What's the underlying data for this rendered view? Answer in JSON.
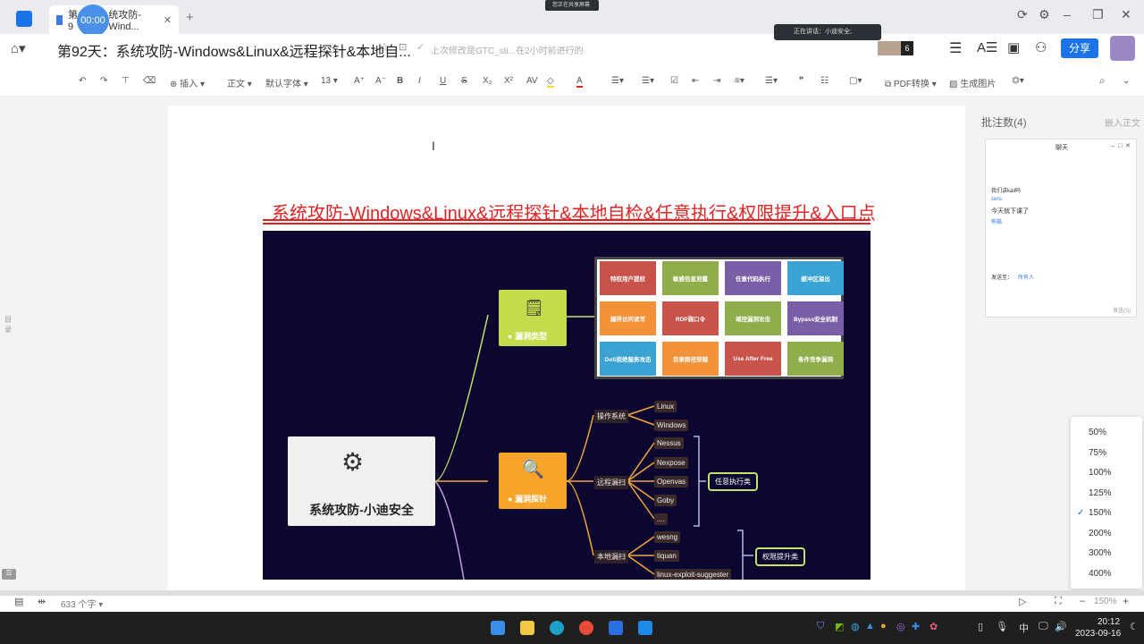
{
  "tabbar": {
    "tab_prefix": "第9",
    "tab_suffix": "统攻防-Wind...",
    "timer": "00:00",
    "share_note": "您正在共享屏幕",
    "speaking": "正在讲话：小迪安全;"
  },
  "header": {
    "title": "第92天：系统攻防-Windows&Linux&远程探针&本地自...",
    "last_edit": "上次修改是GTC_sti...在2小时前进行的",
    "avatar_count": "6",
    "share": "分享"
  },
  "toolbar": {
    "insert": "插入",
    "style": "正文",
    "font": "默认字体",
    "size": "13",
    "pdf": "PDF转换",
    "image": "生成图片"
  },
  "doc": {
    "heading": "系统攻防-Windows&Linux&远程探针&本地自检&任意执行&权限提升&入口点"
  },
  "mindmap": {
    "center": "系统攻防-小迪安全",
    "types_label": "漏洞类型",
    "probe_label": "漏洞探针",
    "grid": [
      {
        "label": "特权用户提权",
        "color": "#c9524a"
      },
      {
        "label": "敏感信息泄露",
        "color": "#8fad4a"
      },
      {
        "label": "任意代码执行",
        "color": "#7b5ea8"
      },
      {
        "label": "缓冲区溢出",
        "color": "#3aa3d4"
      },
      {
        "label": "越界访问读写",
        "color": "#f4923a"
      },
      {
        "label": "RDP弱口令",
        "color": "#c9524a"
      },
      {
        "label": "域控漏洞攻击",
        "color": "#8fad4a"
      },
      {
        "label": "Bypass安全机制",
        "color": "#7b5ea8"
      },
      {
        "label": "DoS拒绝服务攻击",
        "color": "#3aa3d4"
      },
      {
        "label": "目录路径穿越",
        "color": "#f4923a"
      },
      {
        "label": "Use After Free",
        "color": "#c9524a"
      },
      {
        "label": "条件竞争漏洞",
        "color": "#8fad4a"
      }
    ],
    "branches": [
      "操作系统",
      "远程漏扫",
      "本地漏扫"
    ],
    "leaves": [
      "Linux",
      "Windows",
      "Nessus",
      "Nexpose",
      "Openvas",
      "Goby",
      "....",
      "wesng",
      "tiquan",
      "linux-exploit-suggester"
    ],
    "tags": [
      "任意执行类",
      "权限提升类"
    ]
  },
  "sidebar": {
    "toc": "目录",
    "comments": "批注数(4)",
    "embed": "嵌入正文"
  },
  "chat": {
    "title": "聊天",
    "messages": [
      "我们讲kali吗",
      "zero.",
      "今天就下课了",
      "熊猫"
    ],
    "send_to": "发送至：",
    "recipient": "所有人",
    "send": "发送(S)"
  },
  "zoom": {
    "options": [
      "50%",
      "75%",
      "100%",
      "125%",
      "150%",
      "200%",
      "300%",
      "400%"
    ],
    "selected": "150%",
    "current": "150%"
  },
  "status": {
    "word_count": "633 个字"
  },
  "taskbar": {
    "time": "20:12",
    "date": "2023-09-16",
    "ime": "中"
  }
}
